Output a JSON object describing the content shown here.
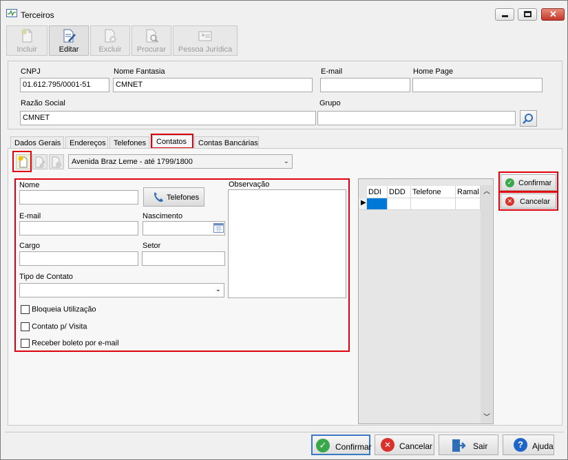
{
  "window": {
    "title": "Terceiros"
  },
  "toolbar": {
    "buttons": [
      {
        "label": "Incluir",
        "enabled": false
      },
      {
        "label": "Editar",
        "enabled": true
      },
      {
        "label": "Excluir",
        "enabled": false
      },
      {
        "label": "Procurar",
        "enabled": false
      },
      {
        "label": "Pessoa Jurídica",
        "enabled": false
      }
    ]
  },
  "header": {
    "cnpj_label": "CNPJ",
    "cnpj_value": "01.612.795/0001-51",
    "fantasia_label": "Nome Fantasia",
    "fantasia_value": "CMNET",
    "email_label": "E-mail",
    "email_value": "",
    "homepage_label": "Home Page",
    "homepage_value": "",
    "razao_label": "Razão Social",
    "razao_value": "CMNET",
    "grupo_label": "Grupo",
    "grupo_value": ""
  },
  "tabs": [
    "Dados Gerais",
    "Endereços",
    "Telefones",
    "Contatos",
    "Contas Bancárias"
  ],
  "contatos": {
    "address_combo": "Avenida Braz Leme - até 1799/1800",
    "nome_label": "Nome",
    "telefones_button": "Telefones",
    "observacao_label": "Observação",
    "email_label": "E-mail",
    "nascimento_label": "Nascimento",
    "cargo_label": "Cargo",
    "setor_label": "Setor",
    "tipo_label": "Tipo de Contato",
    "check_bloqueia": "Bloqueia Utilização",
    "check_visita": "Contato p/ Visita",
    "check_boleto": "Receber boleto por e-mail",
    "grid_headers": [
      "DDI",
      "DDD",
      "Telefone",
      "Ramal"
    ],
    "confirmar": "Confirmar",
    "cancelar": "Cancelar"
  },
  "footer": {
    "confirmar": "Confirmar",
    "cancelar": "Cancelar",
    "sair": "Sair",
    "ajuda": "Ajuda"
  },
  "colors": {
    "highlight": "#e0000b",
    "confirm_green": "#3aa74a",
    "cancel_red": "#d9322a",
    "help_blue": "#1f64c8"
  }
}
